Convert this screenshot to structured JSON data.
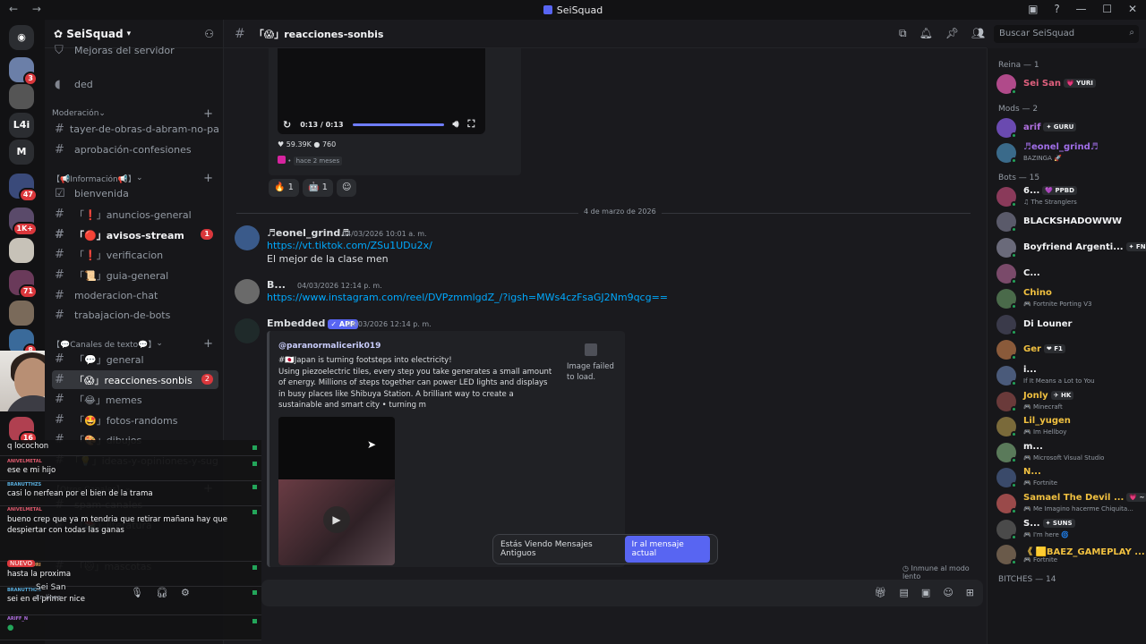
{
  "titlebar": {
    "title": "SeiSquad",
    "nav": "← →",
    "controls": [
      "▣",
      "?",
      "—",
      "☐",
      "✕"
    ]
  },
  "servers": [
    {
      "label": "",
      "badge": "3",
      "color": "#6b7fa8"
    },
    {
      "label": "",
      "badge": "",
      "color": "#555"
    },
    {
      "label": "L4i",
      "badge": "",
      "color": "#2b2d31"
    },
    {
      "label": "M",
      "badge": "",
      "color": "#2b2d31"
    },
    {
      "label": "",
      "badge": "47",
      "color": "#3a4a7a"
    },
    {
      "label": "",
      "badge": "1K+",
      "color": "#5a4a6a"
    },
    {
      "label": "",
      "badge": "",
      "color": "#c7c2b8"
    },
    {
      "label": "",
      "badge": "71",
      "color": "#6a3a5a"
    },
    {
      "label": "",
      "badge": "",
      "color": "#7a6a5a"
    },
    {
      "label": "",
      "badge": "8",
      "color": "#3a6a9a"
    },
    {
      "label": "",
      "badge": "16",
      "color": "#b04050"
    }
  ],
  "sidebar": {
    "server_name": "SeiSquad",
    "channels": [
      {
        "icon": "⛉",
        "label": "Mejoras del servidor",
        "style": ""
      },
      {
        "icon": "◖",
        "label": "ded",
        "style": ""
      },
      {
        "category": "Moderación"
      },
      {
        "icon": "#",
        "label": "tayer-de-obras-d-abram-no-pa...",
        "style": ""
      },
      {
        "icon": "#",
        "label": "aprobación-confesiones",
        "style": ""
      },
      {
        "category": "【📢Información📢】"
      },
      {
        "icon": "☑",
        "label": "bienvenida",
        "style": ""
      },
      {
        "icon": "#",
        "label": "「❗」anuncios-general",
        "style": ""
      },
      {
        "icon": "#",
        "label": "「🔴」avisos-stream",
        "style": "bold",
        "count": "1"
      },
      {
        "icon": "#",
        "label": "「❗」verificacion",
        "style": ""
      },
      {
        "icon": "#",
        "label": "「📜」guia-general",
        "style": ""
      },
      {
        "icon": "#",
        "label": "moderacion-chat",
        "style": ""
      },
      {
        "icon": "#",
        "label": "trabajacion-de-bots",
        "style": ""
      },
      {
        "category": "【💬Canales de texto💬】"
      },
      {
        "icon": "#",
        "label": "「💬」general",
        "style": ""
      },
      {
        "icon": "#",
        "label": "「😱」reacciones-sonbis",
        "style": "active",
        "count": "2"
      },
      {
        "icon": "#",
        "label": "「😂」memes",
        "style": ""
      },
      {
        "icon": "#",
        "label": "「🤩」fotos-randoms",
        "style": ""
      },
      {
        "icon": "#",
        "label": "「🎨」dibujos",
        "style": ""
      },
      {
        "icon": "#",
        "label": "「💡」ideas-y-opiniones-y-sug...",
        "style": ""
      },
      {
        "category": "【Otros Canales】"
      },
      {
        "icon": "#",
        "label": "spam-canales",
        "style": ""
      },
      {
        "icon": "#",
        "label": "「📚」literatura",
        "style": ""
      },
      {
        "icon": "#",
        "label": "「🐱」mascotas",
        "style": ""
      }
    ]
  },
  "channel_header": {
    "name": "「😱」reacciones-sonbis"
  },
  "search": {
    "placeholder": "Buscar SeiSquad"
  },
  "video_player": {
    "time": "0:13 / 0:13",
    "likes": "59.39K",
    "comments": "760",
    "ago": "hace 2 meses"
  },
  "reactions": [
    {
      "emoji": "🔥",
      "count": "1"
    },
    {
      "emoji": "🤖",
      "count": "1"
    },
    {
      "emoji": "☺",
      "count": ""
    }
  ],
  "date_separator": "4 de marzo de 2026",
  "messages": [
    {
      "author": "♬eonel_grind♬",
      "color": "#a06ee8",
      "time": "04/03/2026 10:01 a. m.",
      "lines": [
        {
          "text": "https://vt.tiktok.com/ZSu1UDu2x/",
          "link": true
        },
        {
          "text": "El mejor de la clase men",
          "link": false
        }
      ]
    },
    {
      "author": "B...",
      "color": "#5865f2",
      "time": "04/03/2026 12:14 p. m.",
      "lines": [
        {
          "text": "https://www.instagram.com/reel/DVPzmmlgdZ_/?igsh=MWs4czFsaGJ2Nm9qcg==",
          "link": true
        }
      ]
    },
    {
      "author": "Embedded",
      "color": "#3ba55c",
      "badge": "✓ APP",
      "time": "04/03/2026 12:14 p. m."
    }
  ],
  "embed": {
    "author": "@paranormalicerik019",
    "description": "#🇯🇵Japan is turning footsteps into electricity!\nUsing piezoelectric tiles, every step you take generates a small amount of energy. Millions of steps together can power LED lights and displays in busy places like Shibuya Station. A brilliant way to create a sustainable and smart city • turning m",
    "image_failed": "Image failed to load."
  },
  "old_messages": {
    "text": "Estás Viendo Mensajes Antiguos",
    "button": "Ir al mensaje actual"
  },
  "slowmode": "Inmune al modo lento",
  "members": {
    "groups": [
      {
        "title": "Reina — 1",
        "items": [
          {
            "name": "Sei San",
            "color": "#e0607e",
            "tag": "💗 YURI",
            "sub": ""
          }
        ]
      },
      {
        "title": "Mods — 2",
        "items": [
          {
            "name": "arif",
            "color": "#b070e0",
            "tag": "✦ GURU",
            "sub": ""
          },
          {
            "name": "♬eonel_grind♬",
            "color": "#a06ee8",
            "tag": "",
            "sub": "BAZINGA 🚀"
          }
        ]
      },
      {
        "title": "Bots — 15",
        "items": [
          {
            "name": "6...",
            "color": "#f2f3f5",
            "tag": "💜 PPBD",
            "sub": "♫ The Stranglers"
          },
          {
            "name": "BLACKSHADOWWW",
            "color": "#f2f3f5",
            "tag": "",
            "sub": ""
          },
          {
            "name": "Boyfriend Argenti...",
            "color": "#f2f3f5",
            "tag": "✦ FNF",
            "sub": ""
          },
          {
            "name": "C...",
            "color": "#f2f3f5",
            "tag": "",
            "sub": ""
          },
          {
            "name": "Chino",
            "color": "#f0c040",
            "tag": "",
            "sub": "🎮 Fortnite Porting V3"
          },
          {
            "name": "Di Louner",
            "color": "#f2f3f5",
            "tag": "",
            "sub": ""
          },
          {
            "name": "Ger",
            "color": "#f0c040",
            "tag": "❤ F1",
            "sub": ""
          },
          {
            "name": "i...",
            "color": "#f2f3f5",
            "tag": "",
            "sub": "If It Means a Lot to You"
          },
          {
            "name": "Jonly",
            "color": "#f0c040",
            "tag": "✈ HK",
            "sub": "🎮 Minecraft"
          },
          {
            "name": "Lil_yugen",
            "color": "#f0c040",
            "tag": "",
            "sub": "🎮 Im Hellboy"
          },
          {
            "name": "m...",
            "color": "#f2f3f5",
            "tag": "",
            "sub": "🎮 Microsoft Visual Studio"
          },
          {
            "name": "N...",
            "color": "#f0c040",
            "tag": "",
            "sub": "🎮 Fortnite"
          },
          {
            "name": "Samael The Devil ...",
            "color": "#f0c040",
            "tag": "💗 ~",
            "sub": "🎮 Me Imagino hacerme Chiquita..."
          },
          {
            "name": "S...",
            "color": "#f2f3f5",
            "tag": "✦ SUNS",
            "sub": "🎮 I'm here 🌀"
          },
          {
            "name": "《 🟨BAEZ_GAMEPLAY ...",
            "color": "#f0c040",
            "tag": "",
            "sub": "🎮 Fortnite"
          }
        ]
      },
      {
        "title": "BITCHES — 14",
        "items": []
      }
    ]
  },
  "stream_chat": [
    {
      "user": "",
      "text": "q locochon",
      "color": "#e05a6e"
    },
    {
      "user": "ANIVELMETAL",
      "text": "ese e mi hijo",
      "color": "#e05a6e"
    },
    {
      "user": "BRANUTTHZS",
      "text": "casi lo nerfean por el bien de la trama",
      "color": "#5ab0e0"
    },
    {
      "user": "ANIVELMETAL",
      "text": "bueno crep que ya m tendria que retirar mañana hay que despiertar con todas las ganas",
      "color": "#e05a6e"
    },
    {
      "user": "VENADOGURI",
      "text": "hasta la proxima",
      "color": "#e0a05a"
    },
    {
      "user": "BRANUTTHZS",
      "text": "sei en el primer nice",
      "color": "#5ab0e0"
    },
    {
      "user": "ARIFF_N",
      "text": "●",
      "color": "#b070e0"
    }
  ],
  "user_panel": {
    "name": "Sei San",
    "status": "En línea",
    "badge": "NUEVO"
  }
}
